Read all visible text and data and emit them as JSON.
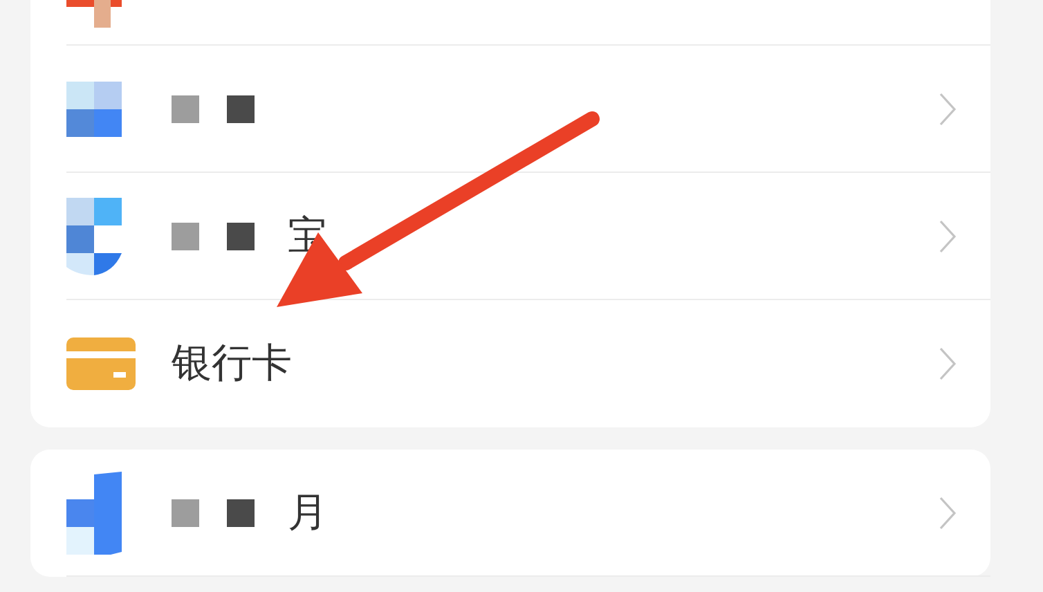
{
  "cards": [
    {
      "rows": [
        {
          "kind": "orange-mosaic",
          "censored": false,
          "label": null,
          "chevron": false
        },
        {
          "kind": "blue-grid",
          "censored": true,
          "label": null,
          "chevron": true
        },
        {
          "kind": "blue-shield",
          "censored": true,
          "label": "宝",
          "chevron": true
        },
        {
          "kind": "bank-card",
          "censored": false,
          "label": "银行卡",
          "chevron": true
        }
      ]
    },
    {
      "rows": [
        {
          "kind": "blue-bar",
          "censored": true,
          "label": "月",
          "chevron": true
        }
      ]
    }
  ]
}
